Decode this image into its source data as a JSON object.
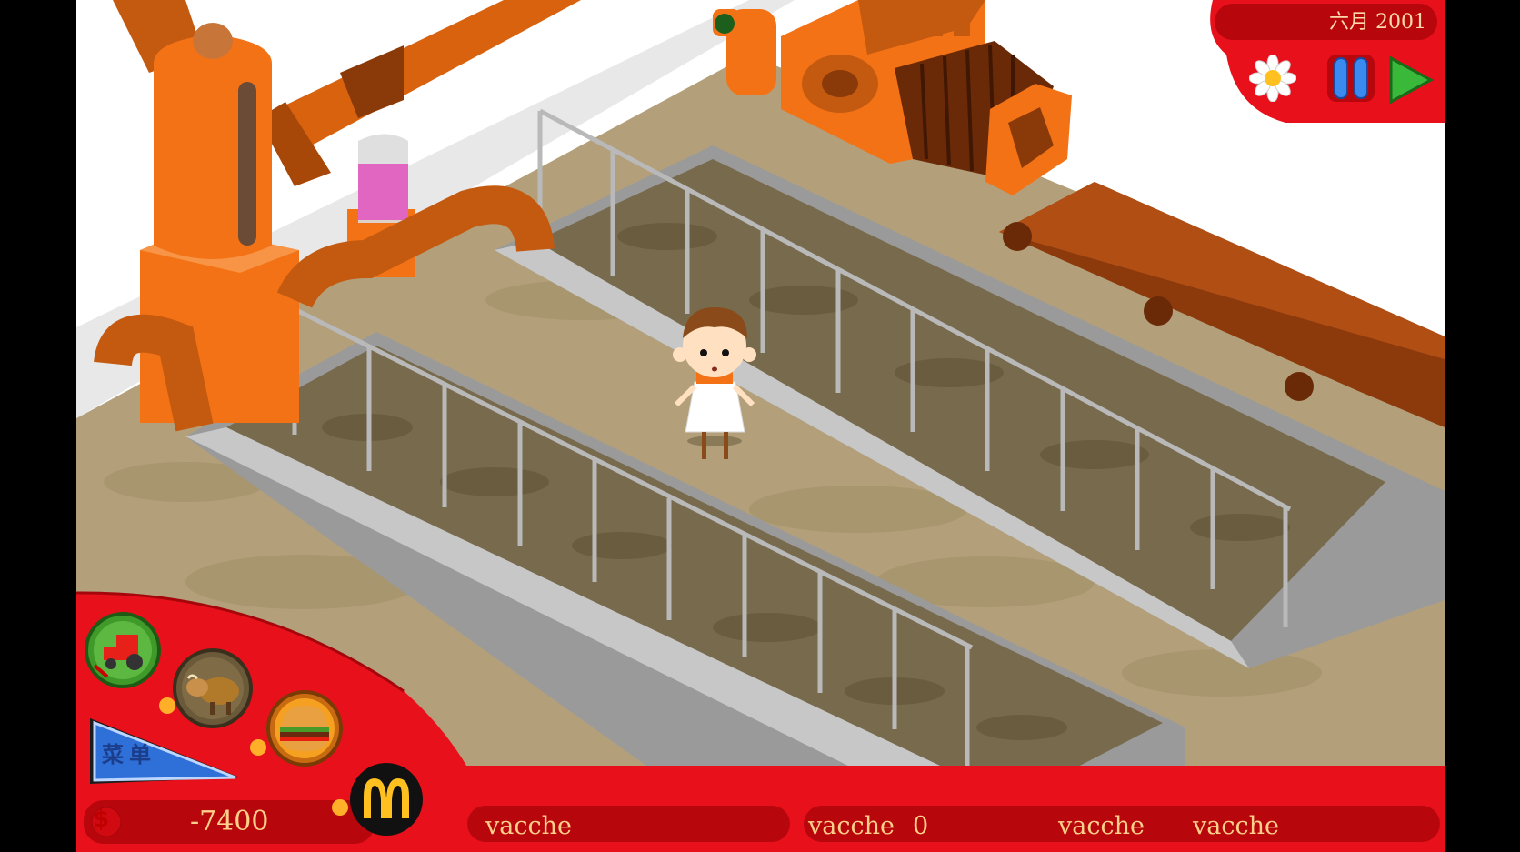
{
  "hud": {
    "date": "六月  2001",
    "money_symbol": "$",
    "money": "-7400",
    "menu_label": "菜单"
  },
  "icons": {
    "settings": "daisy-flower-icon",
    "pause": "pause-icon",
    "play": "play-icon",
    "field": "tractor-icon",
    "livestock": "cow-icon",
    "restaurant": "hamburger-icon",
    "logo": "mcdonalds-arches-logo"
  },
  "status_bar": {
    "slot1": "vacche",
    "slot2_label": "vacche",
    "slot2_value": "0",
    "slot3": "vacche",
    "slot4": "vacche"
  },
  "colors": {
    "hud_red": "#e8101a",
    "hud_dark_red": "#a5060c",
    "machine_orange": "#f47216",
    "floor": "#b5a27d",
    "text_gold": "#ffd08a"
  }
}
